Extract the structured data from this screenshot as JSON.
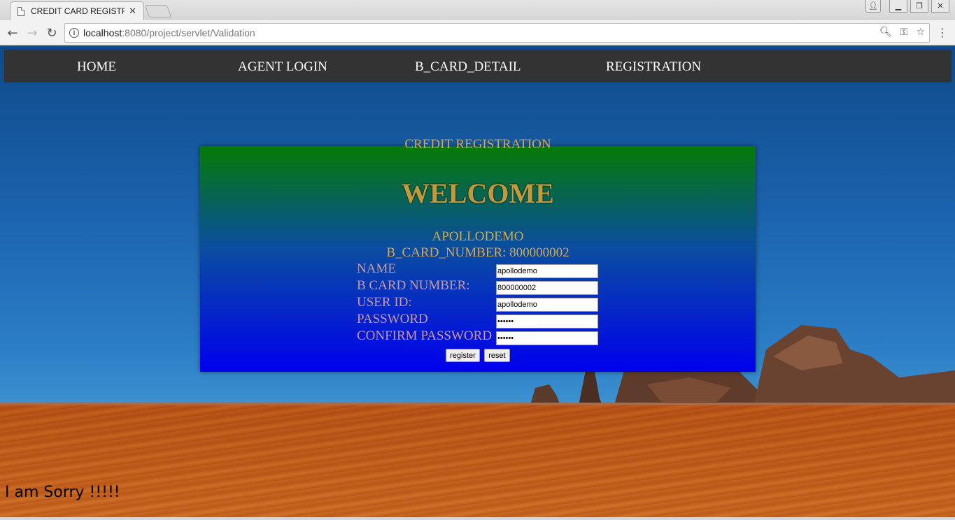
{
  "browser": {
    "tab_title": "CREDIT CARD REGISTRATI",
    "url_host": "localhost",
    "url_rest": ":8080/project/servlet/Validation"
  },
  "nav": {
    "items": [
      "HOME",
      "AGENT LOGIN",
      "B_CARD_DETAIL",
      "REGISTRATION"
    ]
  },
  "panel": {
    "heading": "CREDIT REGISTRATION",
    "welcome": "WELCOME",
    "username": "APOLLODEMO",
    "card_line": "B_CARD_NUMBER: 800000002"
  },
  "form": {
    "fields": [
      {
        "label": "NAME",
        "value": "apollodemo",
        "type": "text"
      },
      {
        "label": "B CARD NUMBER:",
        "value": "800000002",
        "type": "text"
      },
      {
        "label": "USER ID:",
        "value": "apollodemo",
        "type": "text"
      },
      {
        "label": "PASSWORD",
        "value": "••••••",
        "type": "password"
      },
      {
        "label": "CONFIRM PASSWORD",
        "value": "••••••",
        "type": "password"
      }
    ],
    "register_label": "register",
    "reset_label": "reset"
  },
  "message": "I am Sorry !!!!!"
}
